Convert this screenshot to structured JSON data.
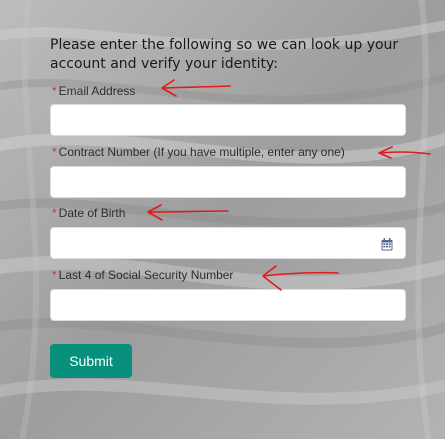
{
  "form": {
    "intro": "Please enter the following so we can look up your account and verify your identity:",
    "required_marker": "*",
    "fields": [
      {
        "label": "Email Address",
        "value": ""
      },
      {
        "label": "Contract Number (If you have multiple, enter any one)",
        "value": ""
      },
      {
        "label": "Date of Birth",
        "value": ""
      },
      {
        "label": "Last 4 of Social Security Number",
        "value": ""
      }
    ],
    "submit_label": "Submit"
  },
  "icons": {
    "date_picker": "calendar-icon"
  },
  "colors": {
    "required": "#c23934",
    "submit_bg": "#08907c",
    "annotation": "#e11b1b"
  }
}
